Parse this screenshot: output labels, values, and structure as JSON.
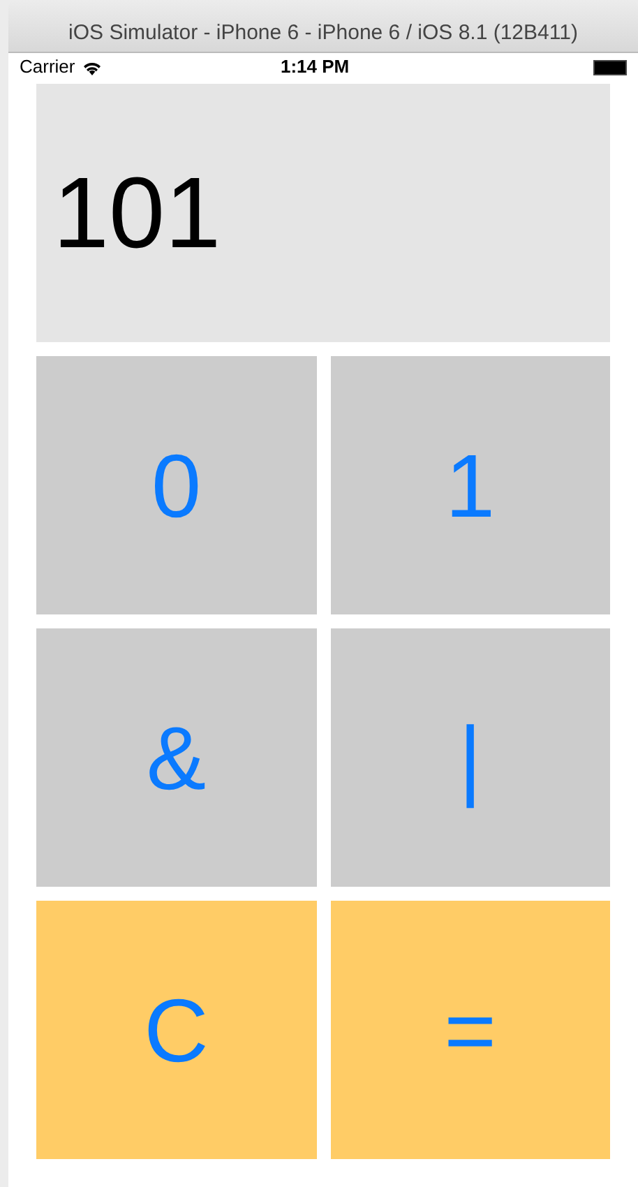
{
  "window": {
    "title": "iOS Simulator - iPhone 6 - iPhone 6 / iOS 8.1 (12B411)"
  },
  "status_bar": {
    "carrier": "Carrier",
    "time": "1:14 PM"
  },
  "display": {
    "value": "101"
  },
  "buttons": [
    {
      "label": "0",
      "kind": "key"
    },
    {
      "label": "1",
      "kind": "key"
    },
    {
      "label": "&",
      "kind": "key"
    },
    {
      "label": "|",
      "kind": "key"
    },
    {
      "label": "C",
      "kind": "action"
    },
    {
      "label": "=",
      "kind": "action"
    }
  ]
}
